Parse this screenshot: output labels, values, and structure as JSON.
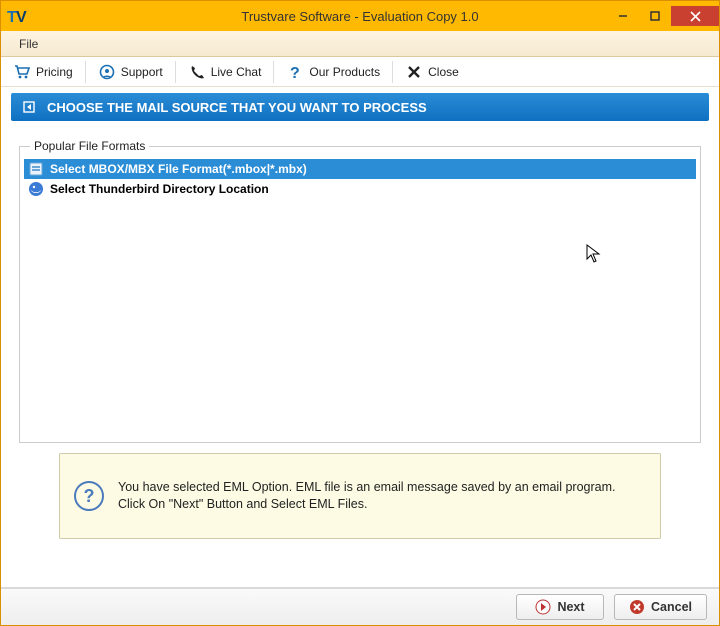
{
  "window": {
    "title": "Trustvare Software - Evaluation Copy 1.0"
  },
  "menu": {
    "file": "File"
  },
  "toolbar": {
    "pricing": "Pricing",
    "support": "Support",
    "live_chat": "Live Chat",
    "our_products": "Our Products",
    "close": "Close"
  },
  "banner": {
    "text": "CHOOSE THE MAIL SOURCE THAT YOU WANT TO PROCESS"
  },
  "group": {
    "legend": "Popular File Formats",
    "options": [
      {
        "label": "Select MBOX/MBX File Format(*.mbox|*.mbx)",
        "selected": true
      },
      {
        "label": "Select Thunderbird Directory Location",
        "selected": false
      }
    ]
  },
  "info": {
    "text": "You have selected EML Option. EML file is an email message saved by an email program. Click On \"Next\" Button and Select EML Files."
  },
  "footer": {
    "next": "Next",
    "cancel": "Cancel"
  }
}
